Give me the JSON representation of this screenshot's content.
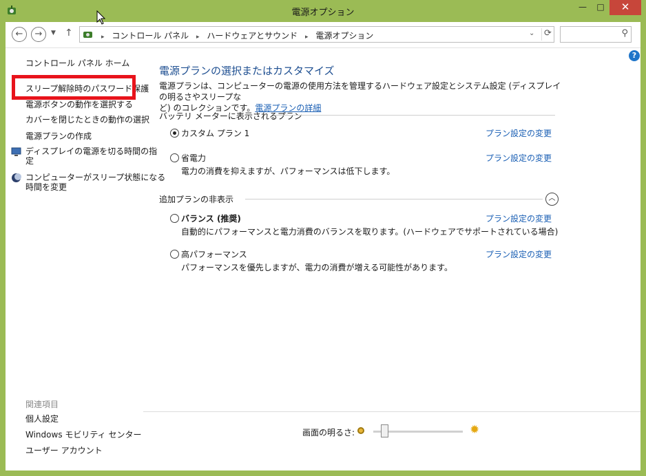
{
  "window": {
    "title": "電源オプション",
    "minimize_icon": "minimize-icon",
    "maximize_icon": "maximize-icon",
    "close_icon": "close-icon"
  },
  "glyphs": {
    "back": "←",
    "forward": "→",
    "dropdown": "▼",
    "up": "↑",
    "chevron": "⌄",
    "refresh": "⟳",
    "search": "⚲",
    "help": "?",
    "collapse": "︿",
    "min": "—",
    "max": "□",
    "close": "✕",
    "sep": "▸",
    "sun": "✹"
  },
  "address": {
    "breadcrumb": [
      "コントロール パネル",
      "ハードウェアとサウンド",
      "電源オプション"
    ],
    "search_placeholder": ""
  },
  "sidebar": {
    "home": "コントロール パネル ホーム",
    "items": [
      {
        "label": "スリープ解除時のパスワード保護"
      },
      {
        "label": "電源ボタンの動作を選択する"
      },
      {
        "label": "カバーを閉じたときの動作の選択"
      },
      {
        "label": "電源プランの作成"
      },
      {
        "label": "ディスプレイの電源を切る時間の指定",
        "label_l1": "ディスプレイの電源を切る時間の指",
        "label_l2": "定",
        "icon": "display-power-icon"
      },
      {
        "label": "コンピューターがスリープ状態になる時間を変更",
        "label_l1": "コンピューターがスリープ状態になる",
        "label_l2": "時間を変更",
        "icon": "sleep-moon-icon"
      }
    ],
    "related_heading": "関連項目",
    "related": [
      "個人設定",
      "Windows モビリティ センター",
      "ユーザー アカウント"
    ]
  },
  "main": {
    "title": "電源プランの選択またはカスタマイズ",
    "intro_line1": "電源プランは、コンピューターの電源の使用方法を管理するハードウェア設定とシステム設定 (ディスプレイの明るさやスリープな",
    "intro_line2_pre": "ど) のコレクションです。",
    "intro_link": "電源プランの詳細",
    "group1_heading": "バッテリ メーターに表示されるプラン",
    "group2_heading": "追加プランの非表示",
    "plans_shown": [
      {
        "name": "カスタム プラン 1",
        "desc": "",
        "selected": true,
        "link": "プラン設定の変更"
      },
      {
        "name": "省電力",
        "desc": "電力の消費を抑えますが、パフォーマンスは低下します。",
        "selected": false,
        "link": "プラン設定の変更"
      }
    ],
    "plans_hidden": [
      {
        "name": "バランス (推奨)",
        "desc": "自動的にパフォーマンスと電力消費のバランスを取ります。(ハードウェアでサポートされている場合)",
        "selected": false,
        "link": "プラン設定の変更"
      },
      {
        "name": "高パフォーマンス",
        "desc": "パフォーマンスを優先しますが、電力の消費が増える可能性があります。",
        "selected": false,
        "link": "プラン設定の変更"
      }
    ]
  },
  "brightness": {
    "label": "画面の明るさ:",
    "level": 0.12
  },
  "colors": {
    "frame": "#9bbb55",
    "highlight": "#e8131b",
    "link": "#1a5fb4",
    "title": "#1e4f91"
  }
}
